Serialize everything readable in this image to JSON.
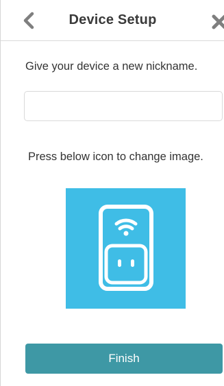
{
  "header": {
    "title": "Device Setup",
    "back_icon": "chevron-left-icon",
    "close_icon": "close-icon"
  },
  "main": {
    "nickname_prompt": "Give your device a new nickname.",
    "nickname_value": "",
    "nickname_placeholder": "",
    "image_hint": "Press below icon to change image.",
    "device_icon": "smart-plug-wifi-icon"
  },
  "footer": {
    "finish_label": "Finish"
  },
  "colors": {
    "accent_button": "#3e98a5",
    "device_tile": "#3fbde6",
    "header_icon": "#7f7f7f",
    "title_text": "#3a3a3a"
  }
}
